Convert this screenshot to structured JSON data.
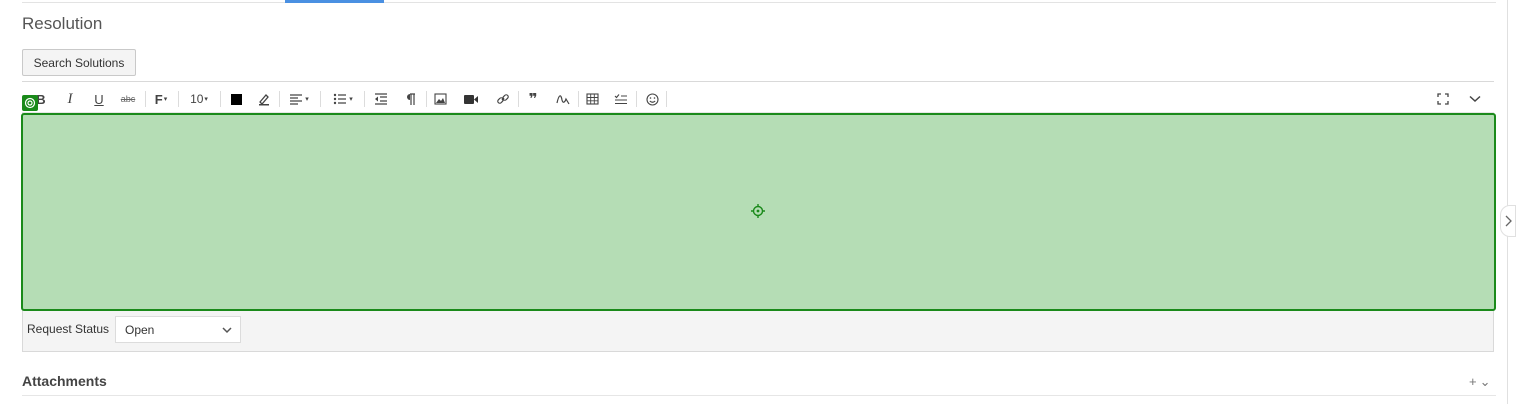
{
  "section": {
    "title": "Resolution"
  },
  "search_button": {
    "label": "Search Solutions"
  },
  "toolbar": {
    "bold": "B",
    "italic": "I",
    "underline": "U",
    "strike": "abc",
    "font_family": "F",
    "font_size": "10",
    "text_color": "#000000",
    "quote_glyph": "❞"
  },
  "request_status": {
    "label": "Request Status",
    "value": "Open"
  },
  "attachments": {
    "title": "Attachments",
    "add": "+",
    "expand": "⌄"
  },
  "colors": {
    "accent": "#4a90e2",
    "highlight_fill": "#b5ddb5",
    "highlight_border": "#1a8a1a"
  }
}
